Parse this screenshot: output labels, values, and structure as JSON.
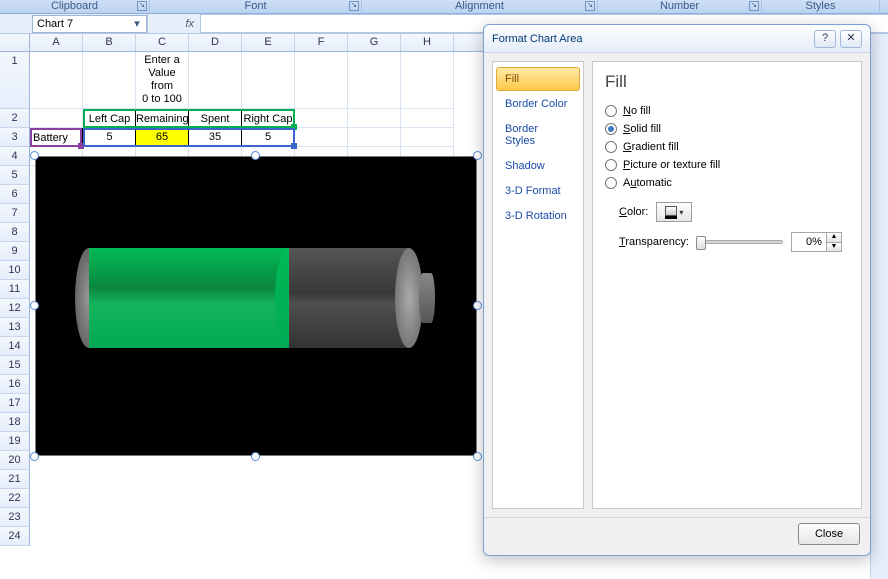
{
  "ribbon": {
    "groups": {
      "clipboard": "Clipboard",
      "font": "Font",
      "alignment": "Alignment",
      "number": "Number",
      "styles": "Styles"
    }
  },
  "namebox": "Chart 7",
  "fx": "fx",
  "columns": [
    "A",
    "B",
    "C",
    "D",
    "E",
    "F",
    "G",
    "H"
  ],
  "rows": [
    "1",
    "2",
    "3",
    "4",
    "5",
    "6",
    "7",
    "8",
    "9",
    "10",
    "11",
    "12",
    "13",
    "14",
    "15",
    "16",
    "17",
    "18",
    "19",
    "20",
    "21",
    "22",
    "23",
    "24"
  ],
  "table": {
    "instruction": "Enter a\nValue from\n0 to 100",
    "headers": {
      "A": "",
      "B": "Left Cap",
      "C": "Remaining",
      "D": "Spent",
      "E": "Right Cap"
    },
    "row": {
      "A": "Battery",
      "B": "5",
      "C": "65",
      "D": "35",
      "E": "5"
    }
  },
  "chart_data": {
    "type": "bar",
    "categories": [
      "Left Cap",
      "Remaining",
      "Spent",
      "Right Cap"
    ],
    "series": [
      {
        "name": "Battery",
        "values": [
          5,
          65,
          35,
          5
        ]
      }
    ],
    "title": "",
    "xlabel": "",
    "ylabel": "",
    "xlim": [
      0,
      110
    ]
  },
  "dialog": {
    "title": "Format Chart Area",
    "nav": [
      "Fill",
      "Border Color",
      "Border Styles",
      "Shadow",
      "3-D Format",
      "3-D Rotation"
    ],
    "nav_selected": "Fill",
    "pane_title": "Fill",
    "options": {
      "no_fill": "No fill",
      "solid_fill": "Solid fill",
      "gradient_fill": "Gradient fill",
      "picture_fill": "Picture or texture fill",
      "automatic": "Automatic"
    },
    "selected_option": "solid_fill",
    "color_label": "Color:",
    "transparency_label": "Transparency:",
    "transparency_value": "0%",
    "close": "Close"
  }
}
